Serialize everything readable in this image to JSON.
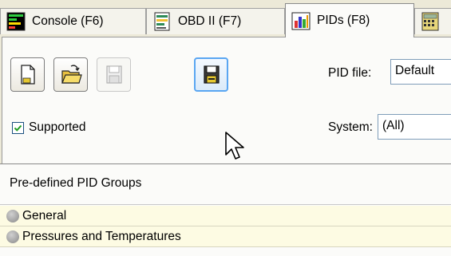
{
  "tabs": [
    {
      "label": "Console (F6)",
      "icon": "console-icon"
    },
    {
      "label": "OBD II (F7)",
      "icon": "obd-document-icon"
    },
    {
      "label": "PIDs (F8)",
      "icon": "pids-chart-icon",
      "active": true
    },
    {
      "label": "",
      "icon": "calculator-icon"
    }
  ],
  "toolbar": {
    "buttons": [
      {
        "name": "new-file-button",
        "icon": "new-file-icon",
        "enabled": true
      },
      {
        "name": "open-file-button",
        "icon": "open-folder-icon",
        "enabled": true
      },
      {
        "name": "save-button",
        "icon": "save-disk-icon",
        "enabled": false
      },
      {
        "name": "save-as-button",
        "icon": "save-as-disk-icon",
        "enabled": true,
        "hovered": true
      }
    ]
  },
  "supported": {
    "label": "Supported",
    "checked": true
  },
  "pid_file": {
    "label": "PID file:",
    "value": "Default"
  },
  "system": {
    "label": "System:",
    "value": "(All)"
  },
  "groups": {
    "header": "Pre-defined PID Groups",
    "items": [
      {
        "label": "General"
      },
      {
        "label": "Pressures and Temperatures"
      }
    ]
  },
  "colors": {
    "background": "#ece9d8",
    "panel": "#fbfbf9",
    "group_row": "#fdfbe3",
    "hover_border": "#5aa6f2"
  }
}
